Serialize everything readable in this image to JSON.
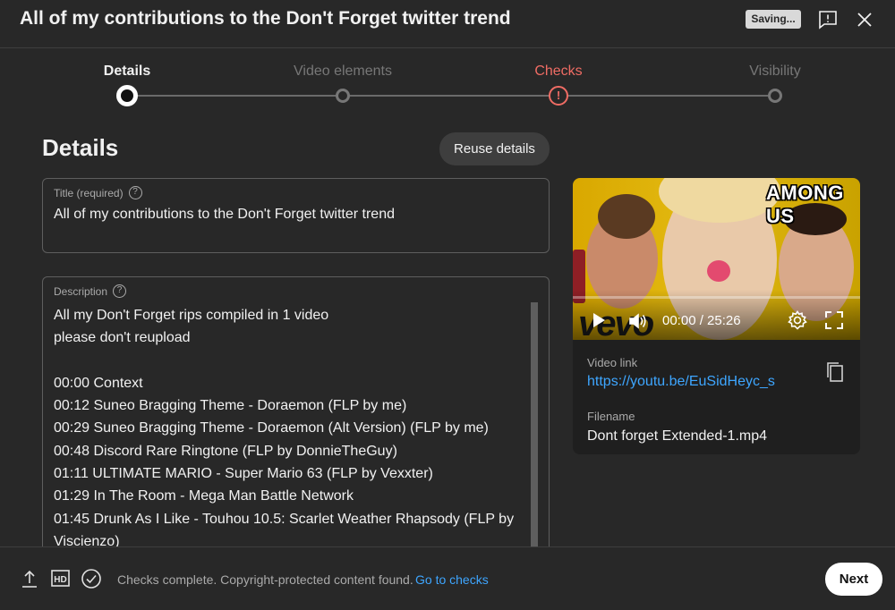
{
  "header": {
    "title": "All of my contributions to the Don't Forget twitter trend",
    "saving_badge": "Saving...",
    "feedback_icon": "feedback-icon",
    "close_icon": "close-icon"
  },
  "stepper": {
    "steps": [
      {
        "label": "Details",
        "state": "active"
      },
      {
        "label": "Video elements",
        "state": "inactive"
      },
      {
        "label": "Checks",
        "state": "warning"
      },
      {
        "label": "Visibility",
        "state": "inactive"
      }
    ],
    "warning_glyph": "!"
  },
  "details": {
    "heading": "Details",
    "reuse_button": "Reuse details",
    "title_field": {
      "label": "Title (required)",
      "help_glyph": "?",
      "value": "All of my contributions to the Don't Forget twitter trend"
    },
    "description_field": {
      "label": "Description",
      "help_glyph": "?",
      "lines": [
        "All my Don't Forget rips compiled in 1 video",
        "please don't reupload",
        "",
        "00:00 Context",
        "00:12 Suneo Bragging Theme - Doraemon (FLP by me)",
        "00:29 Suneo Bragging Theme - Doraemon (Alt Version) (FLP by me)",
        "00:48 Discord Rare Ringtone (FLP by DonnieTheGuy)",
        "01:11 ULTIMATE MARIO - Super Mario 63 (FLP by Vexxter)",
        "01:29 In The Room - Mega Man Battle Network",
        "01:45 Drunk As I Like - Touhou 10.5: Scarlet Weather Rhapsody (FLP by",
        "Viscienzo)"
      ]
    }
  },
  "preview": {
    "thumbnail_text": "AMONG US",
    "watermark": "vevo",
    "time": "00:00 / 25:26",
    "video_link_label": "Video link",
    "video_link": "https://youtu.be/EuSidHeyc_s",
    "filename_label": "Filename",
    "filename": "Dont forget Extended-1.mp4",
    "icons": [
      "play-icon",
      "volume-icon",
      "settings-icon",
      "fullscreen-icon",
      "copy-icon"
    ]
  },
  "footer": {
    "icons": [
      "upload-icon",
      "hd-icon",
      "check-circle-icon"
    ],
    "hd_text": "HD",
    "status": "Checks complete. Copyright-protected content found.",
    "checks_link": "Go to checks",
    "next_button": "Next"
  },
  "colors": {
    "background": "#282828",
    "accent_link": "#3ea6ff",
    "warning": "#ef6c64"
  }
}
